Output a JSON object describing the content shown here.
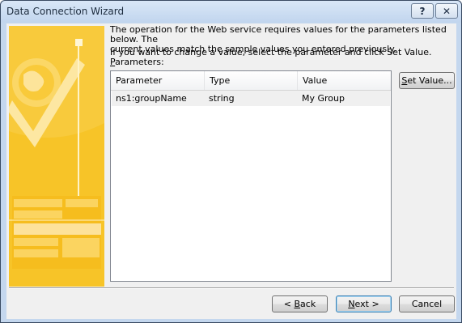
{
  "window": {
    "title": "Data Connection Wizard",
    "help_glyph": "?",
    "close_glyph": "✕"
  },
  "content": {
    "description": "The operation for the Web service requires values for the parameters listed below. The\ncurrent values match the sample values you entered previously.",
    "instruction": "If you want to change a value, select the parameter and click Set Value.",
    "parameters_label_accel": "P",
    "parameters_label_rest": "arameters:"
  },
  "table": {
    "headers": [
      "Parameter",
      "Type",
      "Value"
    ],
    "rows": [
      {
        "parameter": "ns1:groupName",
        "type": "string",
        "value": "My Group"
      }
    ]
  },
  "buttons": {
    "set_value_accel": "S",
    "set_value_rest": "et Value...",
    "back_prefix": "< ",
    "back_accel": "B",
    "back_rest": "ack",
    "next_accel": "N",
    "next_rest": "ext >",
    "cancel": "Cancel"
  },
  "colors": {
    "banner_yellow": "#f7c428",
    "banner_light": "#fde9a0",
    "selected_row": "#f0f0f0"
  }
}
